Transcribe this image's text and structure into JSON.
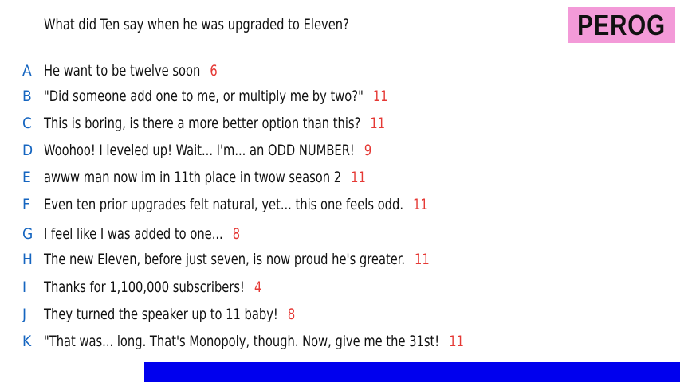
{
  "question": "What did Ten say when he was upgraded to Eleven?",
  "logo": "PEROG",
  "answers": [
    {
      "letter": "A",
      "text": "He want to be twelve soon",
      "votes": "6"
    },
    {
      "letter": "B",
      "text": "\"Did someone add one to me, or multiply me by two?\"",
      "votes": "11"
    },
    {
      "letter": "C",
      "text": "This is boring, is there a more better option than this?",
      "votes": "11"
    },
    {
      "letter": "D",
      "text": "Woohoo! I leveled up! Wait... I'm... an ODD NUMBER!",
      "votes": "9"
    },
    {
      "letter": "E",
      "text": "awww man now im in 11th place in twow season 2",
      "votes": "11"
    },
    {
      "letter": "F",
      "text": "Even ten prior upgrades felt natural, yet... this one feels odd.",
      "votes": "11"
    },
    {
      "letter": "G",
      "text": "I feel like I was added to one...",
      "votes": "8"
    },
    {
      "letter": "H",
      "text": "The new Eleven, before just seven, is now proud he's greater.",
      "votes": "11"
    },
    {
      "letter": "I",
      "text": "Thanks for 1,100,000 subscribers!",
      "votes": "4"
    },
    {
      "letter": "J",
      "text": "They turned the speaker up to 11 baby!",
      "votes": "8"
    },
    {
      "letter": "K",
      "text": "\"That was... long. That's Monopoly, though. Now, give me the 31st!",
      "votes": "11"
    }
  ],
  "colors": {
    "letter": "#1565c0",
    "votes": "#e53935",
    "logo_bg": "#f39ad8",
    "bar": "#0000ee"
  }
}
